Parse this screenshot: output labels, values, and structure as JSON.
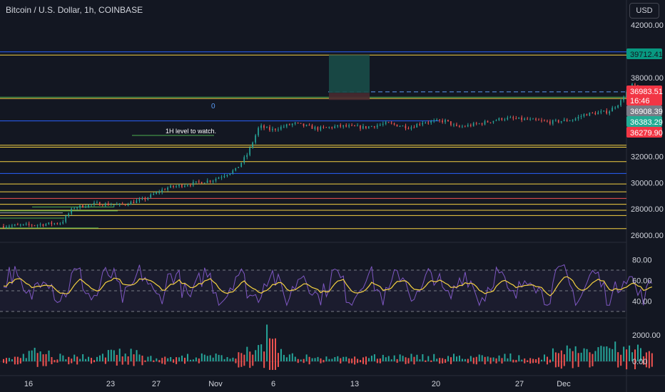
{
  "header": {
    "title": "Bitcoin / U.S. Dollar, 1h, COINBASE",
    "currency_button": "USD"
  },
  "colors": {
    "background": "#131722",
    "axis_text": "#d1d4dc",
    "up": "#26a69a",
    "down": "#ef5350",
    "rsi_line": "#7e57c2",
    "rsi_ma": "#f5d142",
    "blue_line": "#2962ff",
    "yellow_line": "#f5d142",
    "green_line": "#4caf50",
    "red_line": "#ef5350",
    "long_target": "#1a4d48",
    "long_stop": "#4a2a30"
  },
  "annotation": {
    "text": "1H level to watch.",
    "marker": "0"
  },
  "chart_data": [
    {
      "type": "candlestick",
      "title": "Bitcoin / U.S. Dollar, 1h, COINBASE",
      "x_tick_labels": [
        "16",
        "23",
        "27",
        "Nov",
        "6",
        "13",
        "20",
        "27",
        "Dec"
      ],
      "y_tick_labels": [
        "42000.00",
        "38000.00",
        "32000.00",
        "30000.00",
        "28000.00",
        "26000.00"
      ],
      "ylim": [
        25600,
        43000
      ],
      "price_path": [
        [
          0,
          26700
        ],
        [
          3,
          26800
        ],
        [
          5,
          26950
        ],
        [
          6,
          28100
        ],
        [
          8,
          28400
        ],
        [
          10,
          28300
        ],
        [
          12,
          28700
        ],
        [
          14,
          29600
        ],
        [
          16,
          29900
        ],
        [
          18,
          30200
        ],
        [
          20,
          31000
        ],
        [
          21,
          32200
        ],
        [
          22,
          34300
        ],
        [
          23,
          34000
        ],
        [
          25,
          34500
        ],
        [
          27,
          34100
        ],
        [
          29,
          34300
        ],
        [
          31,
          34200
        ],
        [
          33,
          34500
        ],
        [
          35,
          34200
        ],
        [
          36,
          34600
        ],
        [
          38,
          34700
        ],
        [
          39,
          34200
        ],
        [
          41,
          34500
        ],
        [
          43,
          34900
        ],
        [
          45,
          34800
        ],
        [
          47,
          34600
        ],
        [
          49,
          34800
        ],
        [
          50,
          35200
        ],
        [
          52,
          35400
        ],
        [
          53,
          36100
        ],
        [
          54,
          37500
        ],
        [
          55,
          36800
        ],
        [
          56,
          36900
        ]
      ],
      "horizontal_levels": [
        {
          "price": 39950,
          "color": "blue"
        },
        {
          "price": 39710,
          "color": "yellow"
        },
        {
          "price": 36500,
          "color": "green"
        },
        {
          "price": 36400,
          "color": "yellow"
        },
        {
          "price": 34700,
          "color": "blue"
        },
        {
          "price": 32850,
          "color": "yellow"
        },
        {
          "price": 32700,
          "color": "yellow"
        },
        {
          "price": 31600,
          "color": "yellow"
        },
        {
          "price": 30700,
          "color": "blue"
        },
        {
          "price": 29900,
          "color": "yellow"
        },
        {
          "price": 29300,
          "color": "yellow"
        },
        {
          "price": 28800,
          "color": "red"
        },
        {
          "price": 28350,
          "color": "yellow"
        },
        {
          "price": 27900,
          "color": "yellow"
        },
        {
          "price": 27500,
          "color": "yellow"
        },
        {
          "price": 26500,
          "color": "yellow"
        }
      ],
      "price_labels": [
        {
          "value": "39712.41",
          "price": 39712,
          "color": "#089981",
          "text_color": "#131722"
        },
        {
          "value": "36983.51",
          "price": 36983,
          "color": "#f23645",
          "text_color": "#ffffff"
        },
        {
          "value": "16:46",
          "price": 36983,
          "color": "#f23645",
          "text_color": "#ffffff"
        },
        {
          "value": "36908.39",
          "price": 36908,
          "color": "#787b86",
          "text_color": "#ffffff"
        },
        {
          "value": "36383.29",
          "price": 36383,
          "color": "#22ab94",
          "text_color": "#ffffff"
        },
        {
          "value": "36279.90",
          "price": 36279,
          "color": "#f23645",
          "text_color": "#ffffff"
        }
      ],
      "long_position": {
        "entry": 36400,
        "target": 39712,
        "stop": 36279
      }
    },
    {
      "type": "line",
      "name": "RSI",
      "y_tick_labels": [
        "80.00",
        "60.00",
        "40.00"
      ],
      "ylim": [
        30,
        88
      ],
      "bands": {
        "upper": 70,
        "middle": 50,
        "lower": 30
      }
    },
    {
      "type": "histogram",
      "name": "Volume",
      "y_tick_labels": [
        "2000.00",
        "0.00"
      ],
      "ylim": [
        0,
        2900
      ]
    }
  ]
}
